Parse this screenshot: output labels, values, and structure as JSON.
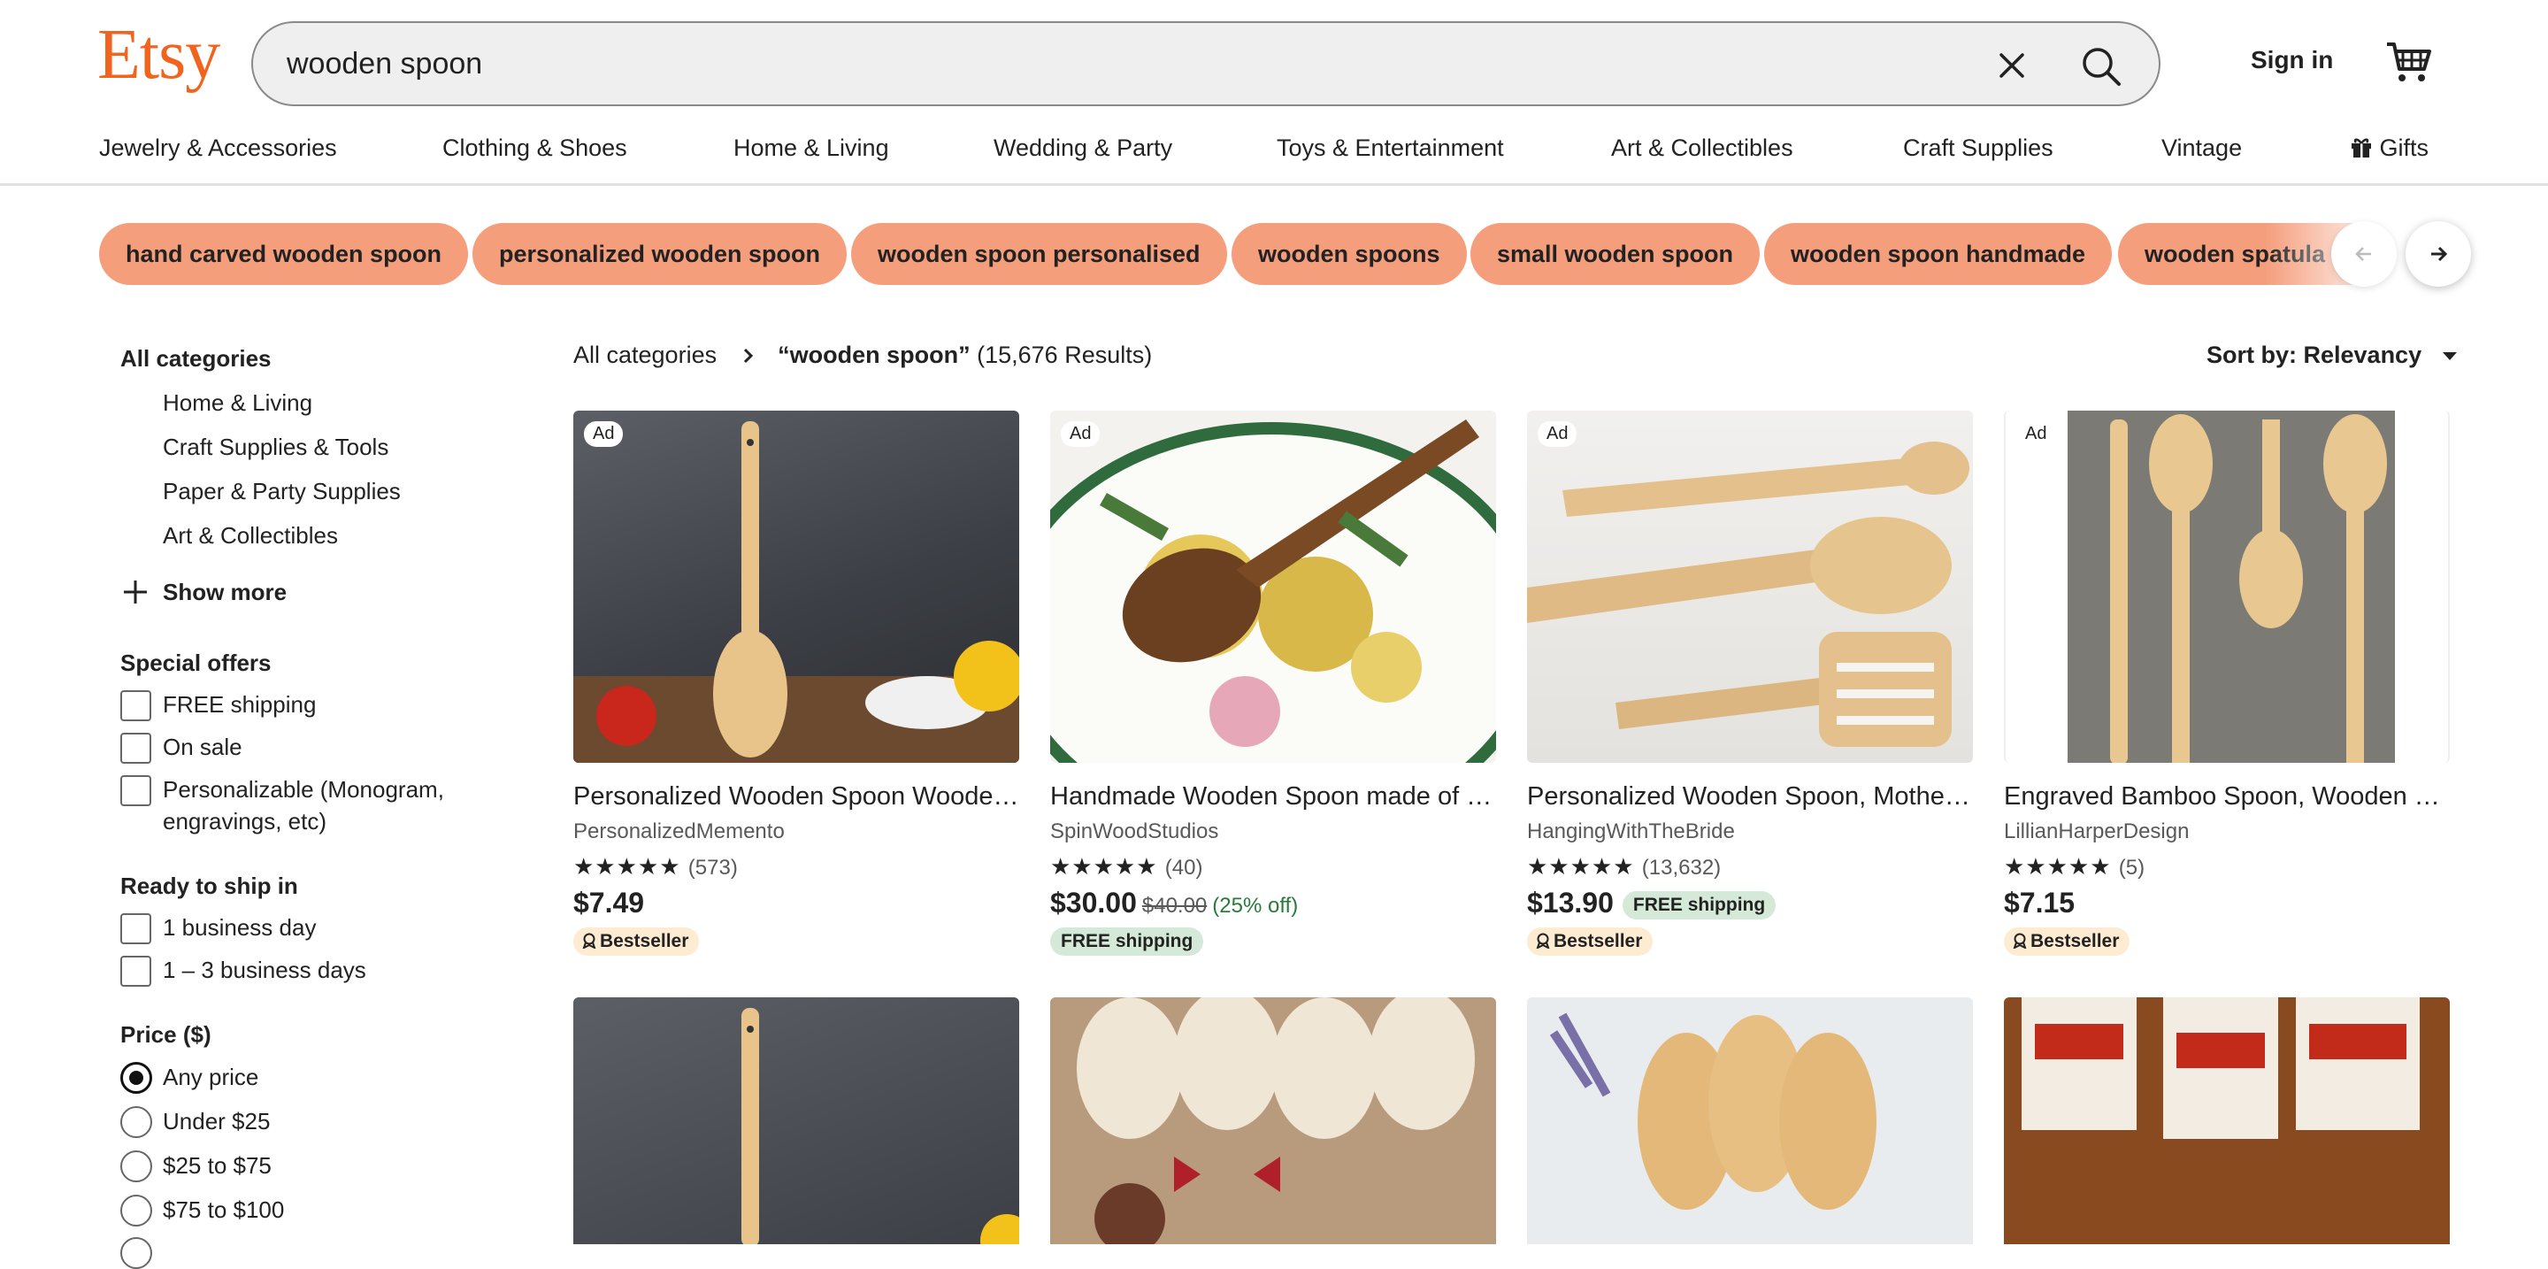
{
  "header": {
    "logo": "Etsy",
    "search_value": "wooden spoon",
    "sign_in": "Sign in"
  },
  "nav": [
    "Jewelry & Accessories",
    "Clothing & Shoes",
    "Home & Living",
    "Wedding & Party",
    "Toys & Entertainment",
    "Art & Collectibles",
    "Craft Supplies",
    "Vintage",
    "Gifts"
  ],
  "chips": [
    "hand carved wooden spoon",
    "personalized wooden spoon",
    "wooden spoon personalised",
    "wooden spoons",
    "small wooden spoon",
    "wooden spoon handmade",
    "wooden spatula"
  ],
  "sidebar": {
    "categories_heading": "All categories",
    "categories": [
      "Home & Living",
      "Craft Supplies & Tools",
      "Paper & Party Supplies",
      "Art & Collectibles"
    ],
    "show_more": "Show more",
    "special_offers_heading": "Special offers",
    "special_offers": [
      "FREE shipping",
      "On sale",
      "Personalizable (Monogram, engravings, etc)"
    ],
    "ready_heading": "Ready to ship in",
    "ready_options": [
      "1 business day",
      "1 – 3 business days"
    ],
    "price_heading": "Price ($)",
    "price_options": [
      "Any price",
      "Under $25",
      "$25 to $75",
      "$75 to $100"
    ]
  },
  "results": {
    "breadcrumb_root": "All categories",
    "query": "“wooden spoon”",
    "count": "(15,676 Results)",
    "sort": "Sort by: Relevancy"
  },
  "listings": [
    {
      "ad": "Ad",
      "title": "Personalized Wooden Spoon Wooden Spoon Custom Engraved",
      "shop": "PersonalizedMemento",
      "stars": "★★★★★",
      "reviews": "(573)",
      "price": "$7.49",
      "badge": "Bestseller"
    },
    {
      "ad": "Ad",
      "title": "Handmade Wooden Spoon made of Cherry Wood",
      "shop": "SpinWoodStudios",
      "stars": "★★★★★",
      "reviews": "(40)",
      "price": "$30.00",
      "orig_price": "$40.00",
      "discount": "(25% off)",
      "free": "FREE shipping"
    },
    {
      "ad": "Ad",
      "title": "Personalized Wooden Spoon, Mother's Day Gift",
      "shop": "HangingWithTheBride",
      "stars": "★★★★★",
      "reviews": "(13,632)",
      "price": "$13.90",
      "free": "FREE shipping",
      "badge": "Bestseller"
    },
    {
      "ad": "Ad",
      "title": "Engraved Bamboo Spoon, Wooden Spoon Custom Logo",
      "shop": "LillianHarperDesign",
      "stars": "★★★★★",
      "reviews": "(5)",
      "price": "$7.15",
      "badge": "Bestseller"
    }
  ],
  "colors": {
    "brand": "#F1641E",
    "chip": "#F59E7C",
    "free_ship_bg": "#D4E9D7",
    "bestseller_bg": "#FDEBD2"
  }
}
